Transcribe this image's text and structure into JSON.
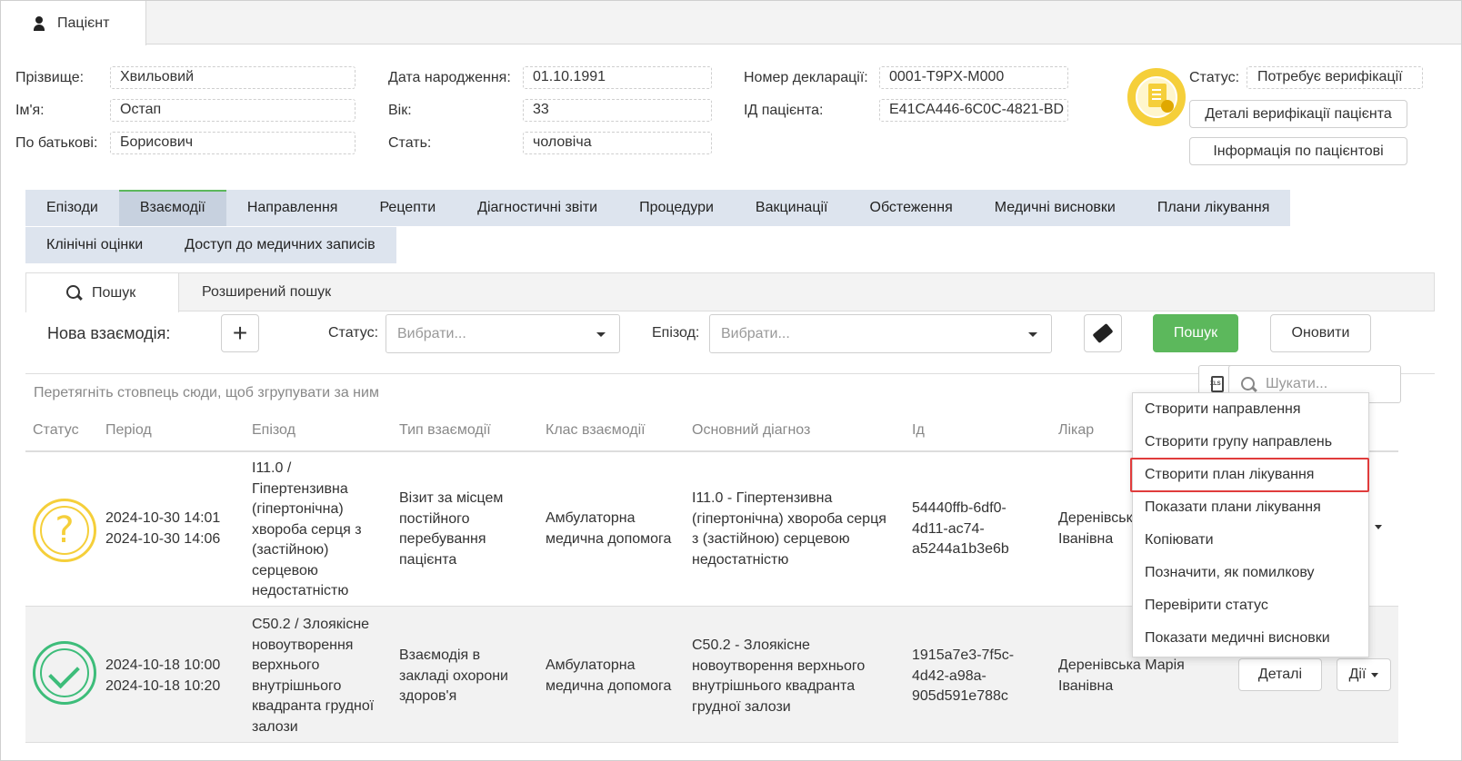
{
  "window": {
    "tab_label": "Пацієнт"
  },
  "patient": {
    "surname_label": "Прізвище:",
    "surname": "Хвильовий",
    "name_label": "Ім'я:",
    "name": "Остап",
    "patronymic_label": "По батькові:",
    "patronymic": "Борисович",
    "birth_label": "Дата народження:",
    "birth": "01.10.1991",
    "age_label": "Вік:",
    "age": "33",
    "sex_label": "Стать:",
    "sex": "чоловіча",
    "declaration_label": "Номер декларації:",
    "declaration": "0001-T9PX-M000",
    "id_label": "ІД пацієнта:",
    "id": "E41CA446-6C0C-4821-BD",
    "status_label": "Статус:",
    "status": "Потребує верифікації",
    "verification_details_button": "Деталі верифікації пацієнта",
    "patient_info_button": "Інформація по пацієнтові"
  },
  "tabs": {
    "row1": [
      "Епізоди",
      "Взаємодії",
      "Направлення",
      "Рецепти",
      "Діагностичні звіти",
      "Процедури",
      "Вакцинації",
      "Обстеження",
      "Медичні висновки",
      "Плани лікування"
    ],
    "row2": [
      "Клінічні оцінки",
      "Доступ до медичних записів"
    ],
    "active": "Взаємодії"
  },
  "subtabs": {
    "search": "Пошук",
    "advanced": "Розширений пошук"
  },
  "filters": {
    "new_label": "Нова взаємодія:",
    "status_label": "Статус:",
    "status_placeholder": "Вибрати...",
    "episode_label": "Епізод:",
    "episode_placeholder": "Вибрати...",
    "search_button": "Пошук",
    "refresh_button": "Оновити"
  },
  "grid": {
    "group_hint": "Перетягніть стовпець сюди, щоб згрупувати за ним",
    "search_placeholder": "Шукати...",
    "columns": [
      "Статус",
      "Період",
      "Епізод",
      "Тип взаємодії",
      "Клас взаємодії",
      "Основний діагноз",
      "Ід",
      "Лікар"
    ],
    "rows": [
      {
        "status_icon": "question-icon",
        "period": [
          "2024-10-30 14:01",
          "2024-10-30 14:06"
        ],
        "episode": [
          "I11.0 /",
          "Гіпертензивна",
          "(гіпертонічна)",
          "хвороба серця з",
          "(застійною)",
          "серцевою",
          "недостатністю"
        ],
        "type": [
          "Візит за місцем",
          "постійного",
          "перебування",
          "пацієнта"
        ],
        "class": [
          "Амбулаторна",
          "медична допомога"
        ],
        "diagnosis": [
          "I11.0 - Гіпертензивна",
          "(гіпертонічна) хвороба серця",
          "з (застійною) серцевою",
          "недостатністю"
        ],
        "id": [
          "54440ffb-6df0-",
          "4d11-ac74-",
          "a5244a1b3e6b"
        ],
        "doctor": [
          "Деренівськ",
          "Іванівна"
        ]
      },
      {
        "status_icon": "check-icon",
        "period": [
          "2024-10-18 10:00",
          "2024-10-18 10:20"
        ],
        "episode": [
          "C50.2 / Злоякісне",
          "новоутворення",
          "верхнього",
          "внутрішнього",
          "квадранта грудної",
          "залози"
        ],
        "type": [
          "Взаємодія в",
          "закладі охорони",
          "здоров'я"
        ],
        "class": [
          "Амбулаторна",
          "медична допомога"
        ],
        "diagnosis": [
          "C50.2 - Злоякісне",
          "новоутворення верхнього",
          "внутрішнього квадранта",
          "грудної залози"
        ],
        "id": [
          "1915a7e3-7f5c-",
          "4d42-a98a-",
          "905d591e788c"
        ],
        "doctor": [
          "Деренівська Марія",
          "Іванівна"
        ],
        "details_button": "Деталі",
        "actions_button": "Дії"
      }
    ]
  },
  "actions_menu": {
    "items": [
      "Створити направлення",
      "Створити групу направлень",
      "Створити план лікування",
      "Показати плани лікування",
      "Копіювати",
      "Позначити, як помилкову",
      "Перевірити статус",
      "Показати медичні висновки"
    ],
    "highlighted": "Створити план лікування"
  },
  "colors": {
    "accent_green": "#5cb85c",
    "tab_bg": "#dde4ee",
    "highlight_red": "#e03c3c",
    "warning_yellow": "#f5cf3a",
    "ok_green": "#3dbd7a"
  }
}
